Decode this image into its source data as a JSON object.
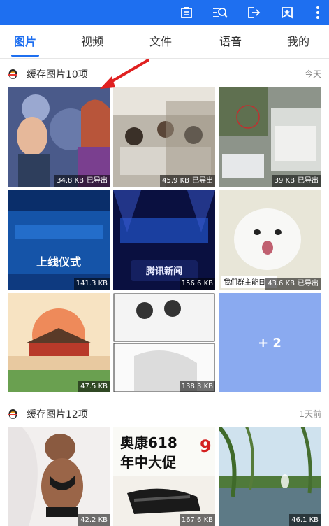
{
  "colors": {
    "brand": "#1e6ff0",
    "annotation_arrow": "#e02020"
  },
  "toolbar": {
    "icons": [
      "camera-icon",
      "search-list-icon",
      "export-icon",
      "star-folder-icon",
      "more-vertical-icon"
    ]
  },
  "tabs": [
    {
      "label": "图片",
      "active": true
    },
    {
      "label": "视频",
      "active": false
    },
    {
      "label": "文件",
      "active": false
    },
    {
      "label": "语音",
      "active": false
    },
    {
      "label": "我的",
      "active": false
    }
  ],
  "sections": [
    {
      "title": "缓存图片10项",
      "date": "今天",
      "items": [
        {
          "size": "34.8 KB",
          "status": "已导出",
          "subject": "frozen-cartoon"
        },
        {
          "size": "45.9 KB",
          "status": "已导出",
          "subject": "restaurant-crowd"
        },
        {
          "size": "39 KB",
          "status": "已导出",
          "subject": "street-truck"
        },
        {
          "size": "141.3 KB",
          "status": "",
          "subject": "launch-ceremony-screen"
        },
        {
          "size": "156.6 KB",
          "status": "",
          "subject": "stage-event-news"
        },
        {
          "size": "43.6 KB",
          "status": "已导出",
          "subject": "white-cat-meme"
        },
        {
          "size": "47.5 KB",
          "status": "",
          "subject": "palace-illustration"
        },
        {
          "size": "138.3 KB",
          "status": "",
          "subject": "manga-page"
        }
      ],
      "more_label": "+ 2"
    },
    {
      "title": "缓存图片12项",
      "date": "1天前",
      "items": [
        {
          "size": "42.2 KB",
          "status": "",
          "subject": "anime-character"
        },
        {
          "size": "167.6 KB",
          "status": "",
          "subject": "sandal-ad"
        },
        {
          "size": "46.1 KB",
          "status": "",
          "subject": "lake-willow"
        }
      ]
    }
  ],
  "image_text": {
    "cat_caption": "我们群主能日",
    "ad_line1": "奥康618",
    "ad_line2": "年中大促",
    "ad_number": "9",
    "stage_banner": "腾讯新闻",
    "ceremony_text": "上线仪式"
  }
}
